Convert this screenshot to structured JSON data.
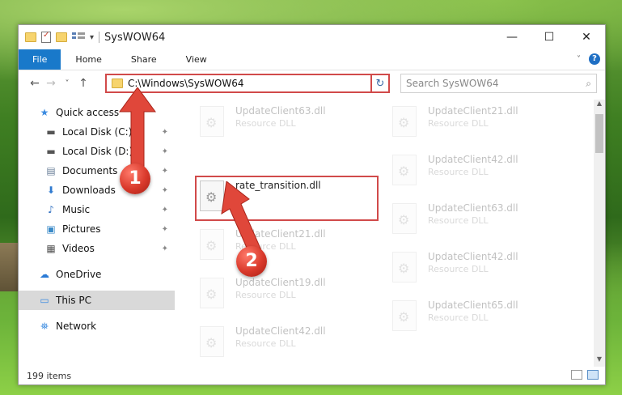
{
  "window": {
    "title": "SysWOW64",
    "controls": {
      "minimize": "—",
      "maximize": "☐",
      "close": "✕"
    }
  },
  "ribbon": {
    "tabs": [
      "File",
      "Home",
      "Share",
      "View"
    ],
    "help_label": "?"
  },
  "nav": {
    "back": "←",
    "forward": "→",
    "recent": "˅",
    "up": "↑",
    "address": "C:\\Windows\\SysWOW64",
    "refresh": "↻",
    "search_placeholder": "Search SysWOW64",
    "search_icon": "⌕"
  },
  "sidebar": {
    "items": [
      {
        "label": "Quick access",
        "icon": "star-icon",
        "glyph": "★",
        "pinned": false
      },
      {
        "label": "Local Disk (C:)",
        "icon": "drive-icon",
        "glyph": "▬",
        "pinned": true
      },
      {
        "label": "Local Disk (D:)",
        "icon": "drive-icon",
        "glyph": "▬",
        "pinned": true
      },
      {
        "label": "Documents",
        "icon": "documents-icon",
        "glyph": "▤",
        "pinned": true
      },
      {
        "label": "Downloads",
        "icon": "downloads-icon",
        "glyph": "⬇",
        "pinned": true
      },
      {
        "label": "Music",
        "icon": "music-icon",
        "glyph": "♪",
        "pinned": true
      },
      {
        "label": "Pictures",
        "icon": "pictures-icon",
        "glyph": "▣",
        "pinned": true
      },
      {
        "label": "Videos",
        "icon": "videos-icon",
        "glyph": "▦",
        "pinned": true
      },
      {
        "label": "OneDrive",
        "icon": "onedrive-icon",
        "glyph": "☁",
        "pinned": false
      },
      {
        "label": "This PC",
        "icon": "computer-icon",
        "glyph": "▭",
        "pinned": false
      },
      {
        "label": "Network",
        "icon": "network-icon",
        "glyph": "⛯",
        "pinned": false
      }
    ],
    "pin_glyph": "📌"
  },
  "files": {
    "left": [
      {
        "name": "UpdateClient63.dll",
        "type": "Resource DLL"
      },
      {
        "name": "rate_transition.dll",
        "type": ""
      },
      {
        "name": "UpdateClient21.dll",
        "type": "Resource DLL"
      },
      {
        "name": "UpdateClient19.dll",
        "type": "Resource DLL"
      },
      {
        "name": "UpdateClient42.dll",
        "type": "Resource DLL"
      }
    ],
    "right": [
      {
        "name": "UpdateClient21.dll",
        "type": "Resource DLL"
      },
      {
        "name": "UpdateClient42.dll",
        "type": "Resource DLL"
      },
      {
        "name": "UpdateClient63.dll",
        "type": "Resource DLL"
      },
      {
        "name": "UpdateClient42.dll",
        "type": "Resource DLL"
      },
      {
        "name": "UpdateClient65.dll",
        "type": "Resource DLL"
      }
    ]
  },
  "status": {
    "item_count": "199 items"
  },
  "annotations": {
    "step1": "1",
    "step2": "2"
  },
  "colors": {
    "highlight": "#d14a4a",
    "accent": "#1979ca",
    "selected": "#d9d9d9"
  }
}
